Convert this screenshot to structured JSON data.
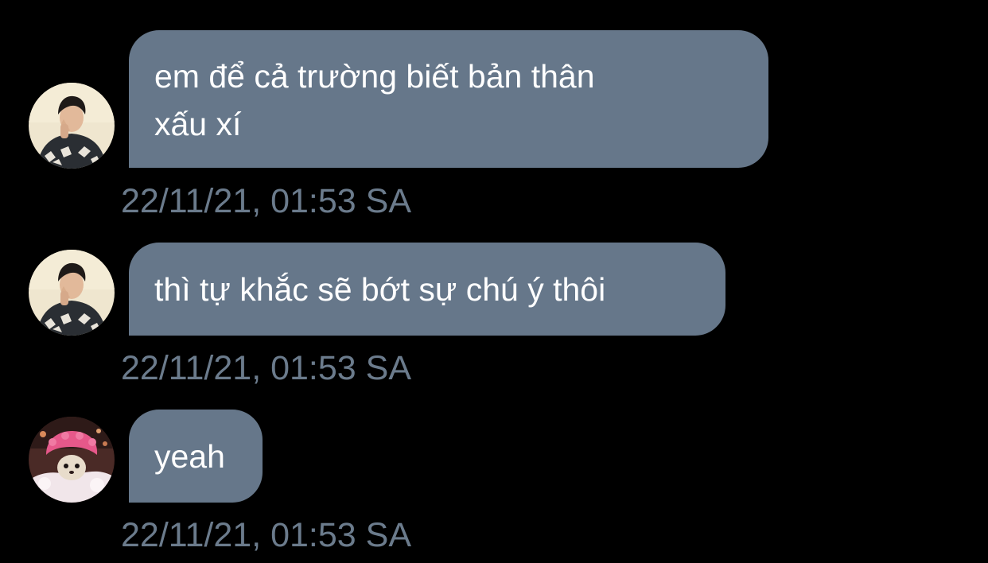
{
  "messages": [
    {
      "text": "em để cả trường biết bản thân\nxấu xí",
      "timestamp": "22/11/21, 01:53 SA",
      "avatar": "person-avatar"
    },
    {
      "text": "thì tự khắc sẽ bớt sự chú ý thôi",
      "timestamp": "22/11/21, 01:53 SA",
      "avatar": "person-avatar"
    },
    {
      "text": "yeah",
      "timestamp": "22/11/21, 01:53 SA",
      "avatar": "dog-avatar"
    }
  ],
  "colors": {
    "background": "#000000",
    "bubble": "#66778a",
    "bubble_text": "#ffffff",
    "timestamp": "#6b7b8c"
  }
}
